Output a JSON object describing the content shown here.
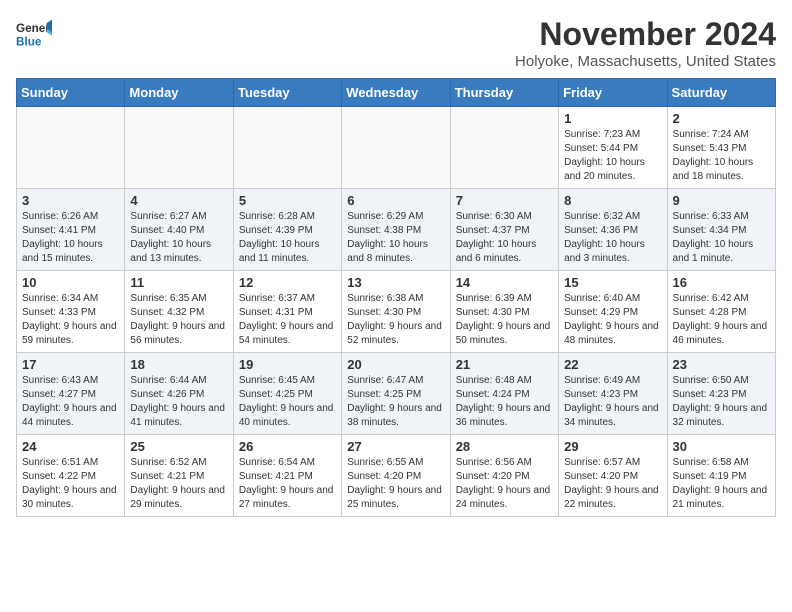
{
  "header": {
    "logo_line1": "General",
    "logo_line2": "Blue",
    "month_title": "November 2024",
    "location": "Holyoke, Massachusetts, United States"
  },
  "days_of_week": [
    "Sunday",
    "Monday",
    "Tuesday",
    "Wednesday",
    "Thursday",
    "Friday",
    "Saturday"
  ],
  "weeks": [
    [
      {
        "day": "",
        "info": ""
      },
      {
        "day": "",
        "info": ""
      },
      {
        "day": "",
        "info": ""
      },
      {
        "day": "",
        "info": ""
      },
      {
        "day": "",
        "info": ""
      },
      {
        "day": "1",
        "info": "Sunrise: 7:23 AM\nSunset: 5:44 PM\nDaylight: 10 hours and 20 minutes."
      },
      {
        "day": "2",
        "info": "Sunrise: 7:24 AM\nSunset: 5:43 PM\nDaylight: 10 hours and 18 minutes."
      }
    ],
    [
      {
        "day": "3",
        "info": "Sunrise: 6:26 AM\nSunset: 4:41 PM\nDaylight: 10 hours and 15 minutes."
      },
      {
        "day": "4",
        "info": "Sunrise: 6:27 AM\nSunset: 4:40 PM\nDaylight: 10 hours and 13 minutes."
      },
      {
        "day": "5",
        "info": "Sunrise: 6:28 AM\nSunset: 4:39 PM\nDaylight: 10 hours and 11 minutes."
      },
      {
        "day": "6",
        "info": "Sunrise: 6:29 AM\nSunset: 4:38 PM\nDaylight: 10 hours and 8 minutes."
      },
      {
        "day": "7",
        "info": "Sunrise: 6:30 AM\nSunset: 4:37 PM\nDaylight: 10 hours and 6 minutes."
      },
      {
        "day": "8",
        "info": "Sunrise: 6:32 AM\nSunset: 4:36 PM\nDaylight: 10 hours and 3 minutes."
      },
      {
        "day": "9",
        "info": "Sunrise: 6:33 AM\nSunset: 4:34 PM\nDaylight: 10 hours and 1 minute."
      }
    ],
    [
      {
        "day": "10",
        "info": "Sunrise: 6:34 AM\nSunset: 4:33 PM\nDaylight: 9 hours and 59 minutes."
      },
      {
        "day": "11",
        "info": "Sunrise: 6:35 AM\nSunset: 4:32 PM\nDaylight: 9 hours and 56 minutes."
      },
      {
        "day": "12",
        "info": "Sunrise: 6:37 AM\nSunset: 4:31 PM\nDaylight: 9 hours and 54 minutes."
      },
      {
        "day": "13",
        "info": "Sunrise: 6:38 AM\nSunset: 4:30 PM\nDaylight: 9 hours and 52 minutes."
      },
      {
        "day": "14",
        "info": "Sunrise: 6:39 AM\nSunset: 4:30 PM\nDaylight: 9 hours and 50 minutes."
      },
      {
        "day": "15",
        "info": "Sunrise: 6:40 AM\nSunset: 4:29 PM\nDaylight: 9 hours and 48 minutes."
      },
      {
        "day": "16",
        "info": "Sunrise: 6:42 AM\nSunset: 4:28 PM\nDaylight: 9 hours and 46 minutes."
      }
    ],
    [
      {
        "day": "17",
        "info": "Sunrise: 6:43 AM\nSunset: 4:27 PM\nDaylight: 9 hours and 44 minutes."
      },
      {
        "day": "18",
        "info": "Sunrise: 6:44 AM\nSunset: 4:26 PM\nDaylight: 9 hours and 41 minutes."
      },
      {
        "day": "19",
        "info": "Sunrise: 6:45 AM\nSunset: 4:25 PM\nDaylight: 9 hours and 40 minutes."
      },
      {
        "day": "20",
        "info": "Sunrise: 6:47 AM\nSunset: 4:25 PM\nDaylight: 9 hours and 38 minutes."
      },
      {
        "day": "21",
        "info": "Sunrise: 6:48 AM\nSunset: 4:24 PM\nDaylight: 9 hours and 36 minutes."
      },
      {
        "day": "22",
        "info": "Sunrise: 6:49 AM\nSunset: 4:23 PM\nDaylight: 9 hours and 34 minutes."
      },
      {
        "day": "23",
        "info": "Sunrise: 6:50 AM\nSunset: 4:23 PM\nDaylight: 9 hours and 32 minutes."
      }
    ],
    [
      {
        "day": "24",
        "info": "Sunrise: 6:51 AM\nSunset: 4:22 PM\nDaylight: 9 hours and 30 minutes."
      },
      {
        "day": "25",
        "info": "Sunrise: 6:52 AM\nSunset: 4:21 PM\nDaylight: 9 hours and 29 minutes."
      },
      {
        "day": "26",
        "info": "Sunrise: 6:54 AM\nSunset: 4:21 PM\nDaylight: 9 hours and 27 minutes."
      },
      {
        "day": "27",
        "info": "Sunrise: 6:55 AM\nSunset: 4:20 PM\nDaylight: 9 hours and 25 minutes."
      },
      {
        "day": "28",
        "info": "Sunrise: 6:56 AM\nSunset: 4:20 PM\nDaylight: 9 hours and 24 minutes."
      },
      {
        "day": "29",
        "info": "Sunrise: 6:57 AM\nSunset: 4:20 PM\nDaylight: 9 hours and 22 minutes."
      },
      {
        "day": "30",
        "info": "Sunrise: 6:58 AM\nSunset: 4:19 PM\nDaylight: 9 hours and 21 minutes."
      }
    ]
  ]
}
